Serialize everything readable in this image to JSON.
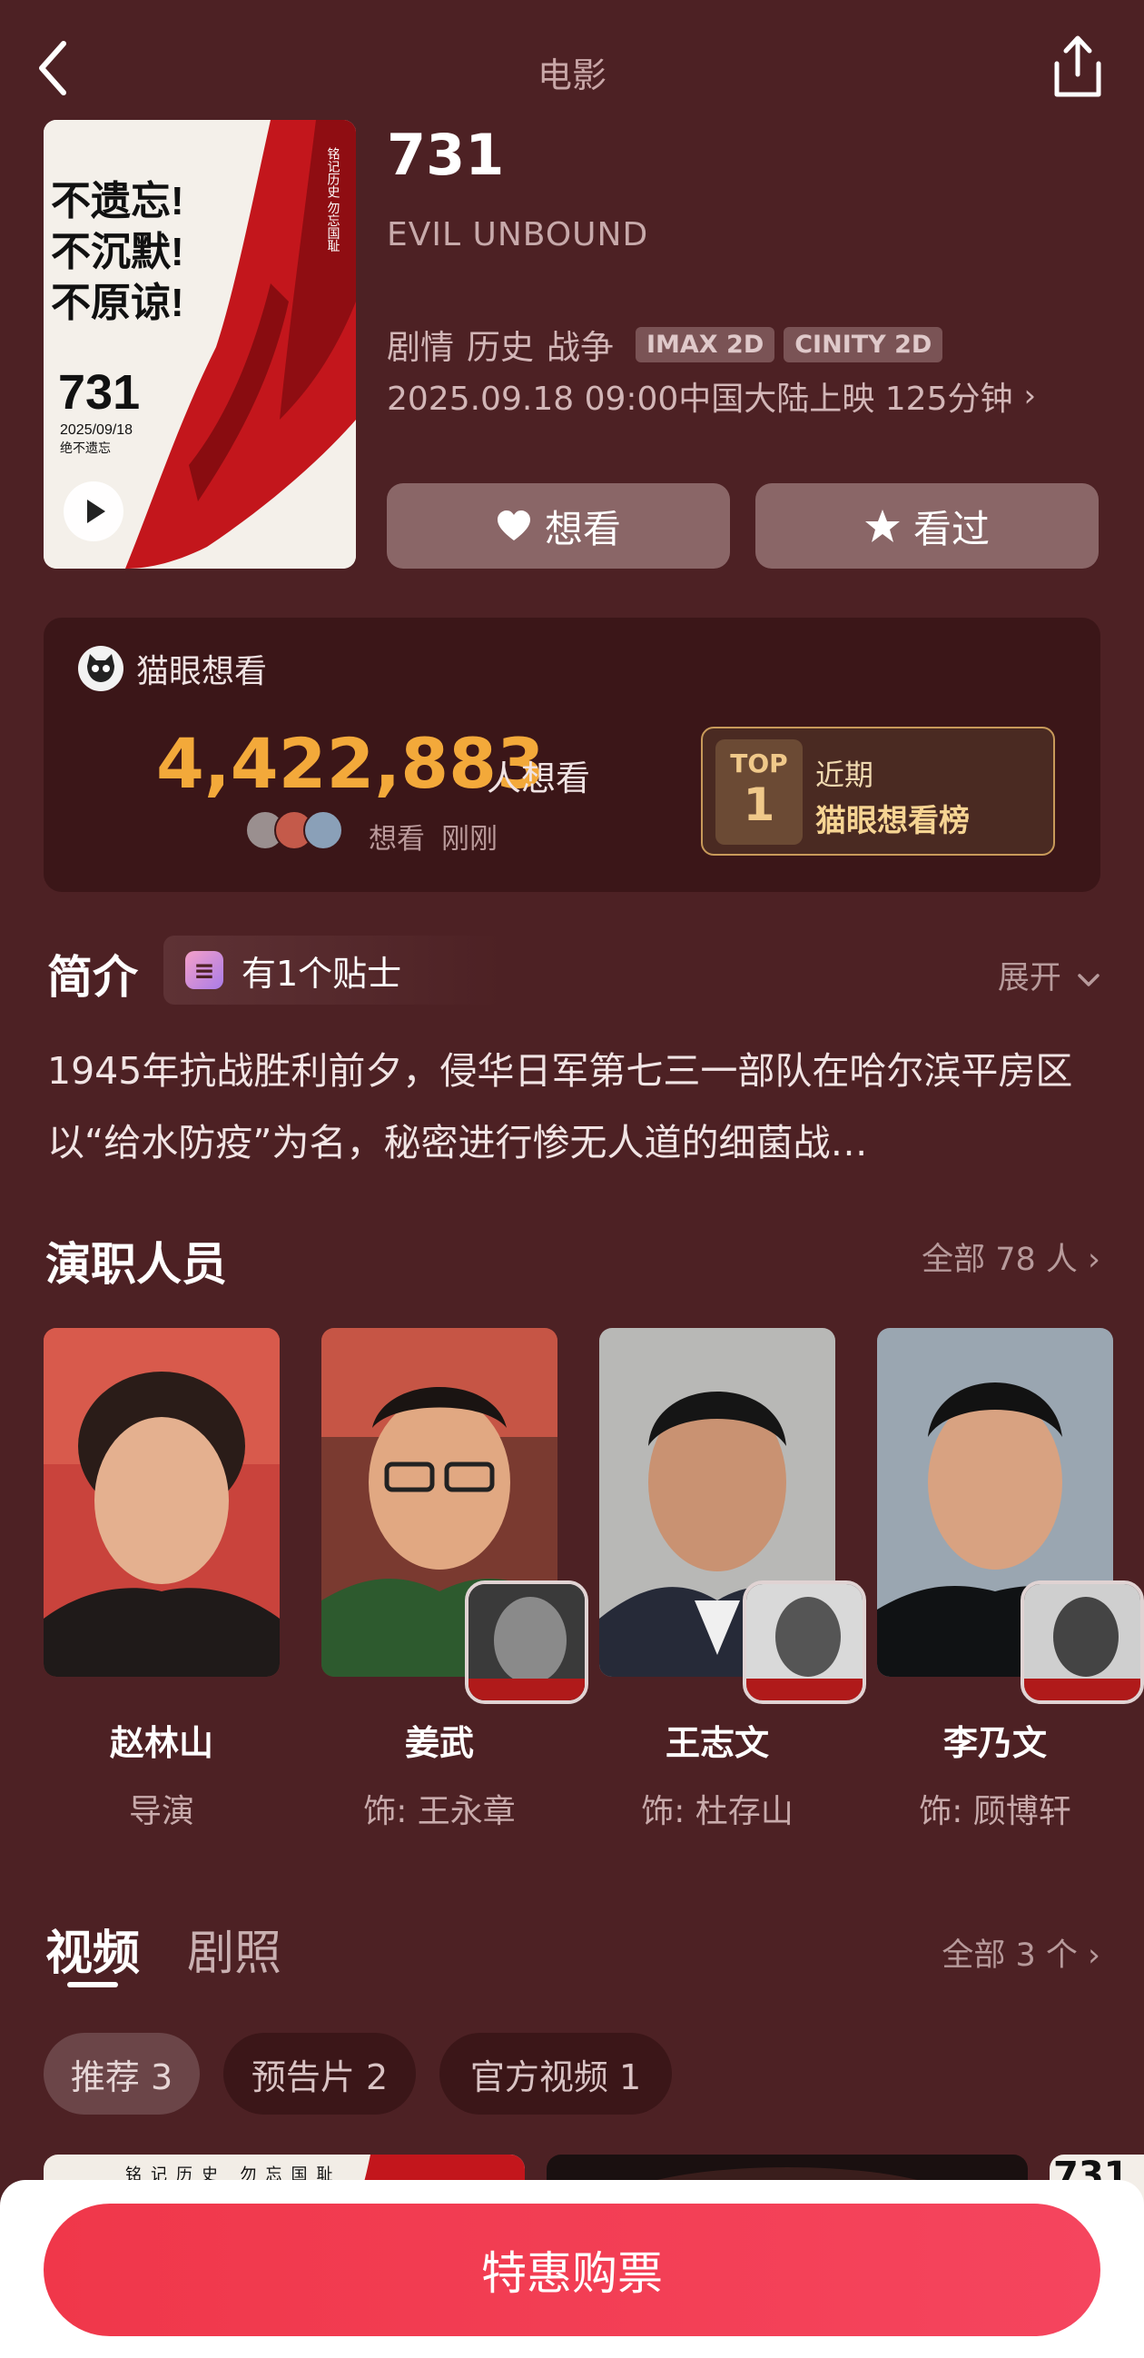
{
  "header": {
    "title": "电影"
  },
  "movie": {
    "title": "731",
    "english_title": "EVIL UNBOUND",
    "genres": [
      "剧情",
      "历史",
      "战争"
    ],
    "formats": [
      "IMAX 2D",
      "CINITY 2D"
    ],
    "release": "2025.09.18 09:00中国大陆上映 125分钟",
    "poster": {
      "slogan_lines": [
        "不遗忘!",
        "不沉默!",
        "不原谅!"
      ],
      "title": "731",
      "date": "2025/09/18",
      "tagline": "绝不遗忘",
      "vertical_text": "铭记历史 勿忘国耻"
    }
  },
  "actions": {
    "want": "想看",
    "seen": "看过"
  },
  "want_card": {
    "source": "猫眼想看",
    "count": "4,422,883",
    "count_suffix": "人想看",
    "meta_action": "想看",
    "meta_time": "刚刚",
    "rank_label": "TOP",
    "rank_number": "1",
    "rank_period": "近期",
    "rank_title": "猫眼想看榜"
  },
  "intro": {
    "title": "简介",
    "tip": "有1个贴士",
    "expand": "展开",
    "synopsis": "1945年抗战胜利前夕，侵华日军第七三一部队在哈尔滨平房区以“给水防疫”为名，秘密进行惨无人道的细菌战…"
  },
  "cast": {
    "title": "演职人员",
    "see_all": "全部 78 人",
    "members": [
      {
        "name": "赵林山",
        "role": "导演"
      },
      {
        "name": "姜武",
        "role": "饰: 王永章"
      },
      {
        "name": "王志文",
        "role": "饰: 杜存山"
      },
      {
        "name": "李乃文",
        "role": "饰: 顾博轩"
      }
    ]
  },
  "videos": {
    "tab_videos": "视频",
    "tab_stills": "剧照",
    "see_all": "全部 3 个",
    "chips": [
      "推荐 3",
      "预告片 2",
      "官方视频 1"
    ],
    "thumb_vertical_text": "铭记历史 勿忘国耻",
    "thumb_title": "731"
  },
  "bottom": {
    "buy": "特惠购票"
  },
  "colors": {
    "background": "#4d2124",
    "accent_orange": "#f3a93a",
    "buy_red": "#f0374a",
    "gold": "#f6d493"
  }
}
